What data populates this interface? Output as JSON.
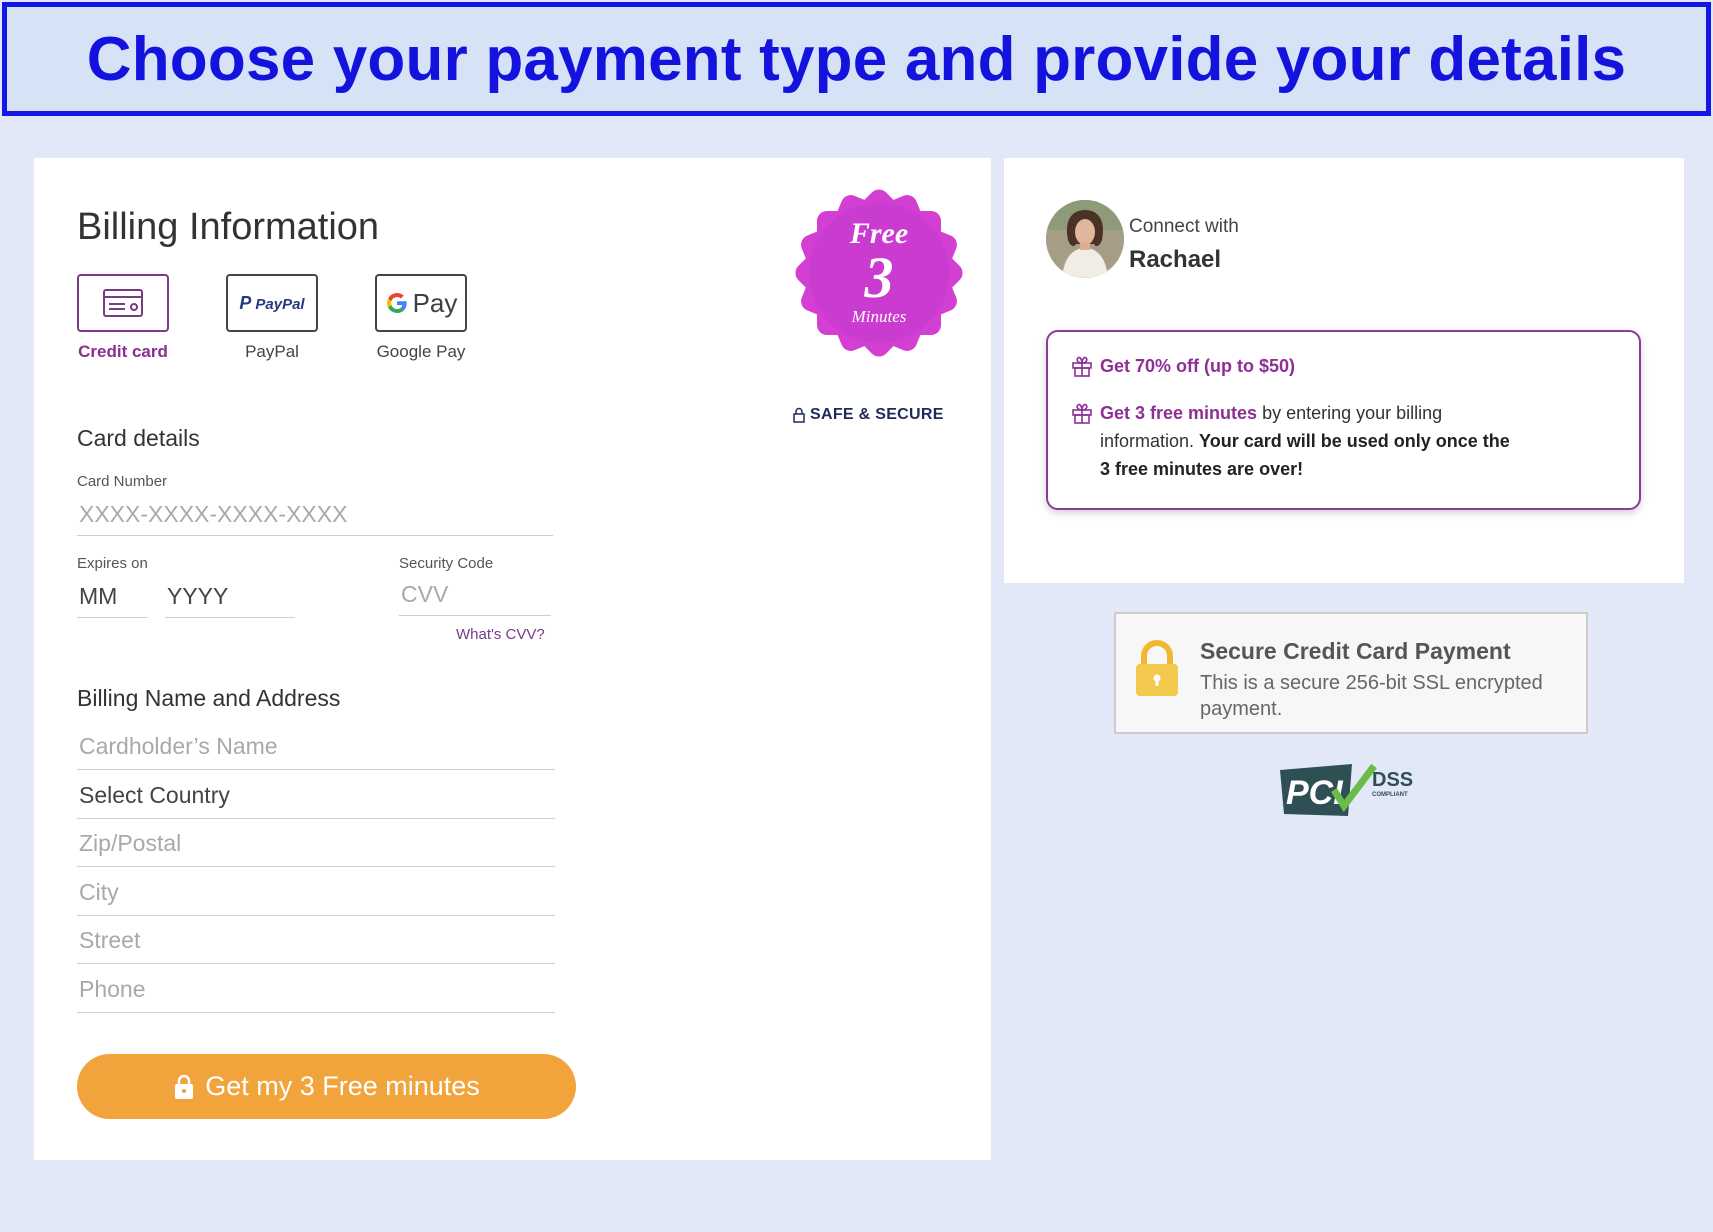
{
  "banner": {
    "title": "Choose your payment type and provide your details"
  },
  "billing": {
    "title": "Billing Information",
    "methods": [
      {
        "label": "Credit card",
        "icon": "credit-card-icon",
        "active": true
      },
      {
        "label": "PayPal",
        "icon": "paypal-logo"
      },
      {
        "label": "Google Pay",
        "icon": "google-pay-logo"
      }
    ],
    "paypal_logo_text": "PayPal",
    "gpay_logo_text": "Pay",
    "badge": {
      "free": "Free",
      "number": "3",
      "minutes": "Minutes",
      "color": "#d23fd2"
    },
    "safe_label": "SAFE & SECURE",
    "card_details_title": "Card details",
    "card_number_label": "Card Number",
    "card_number_placeholder": "XXXX-XXXX-XXXX-XXXX",
    "expires_label": "Expires on",
    "mm_placeholder": "MM",
    "yyyy_placeholder": "YYYY",
    "security_code_label": "Security Code",
    "cvv_placeholder": "CVV",
    "whats_cvv": "What's CVV?",
    "address_title": "Billing Name and Address",
    "cardholder_placeholder": "Cardholder’s Name",
    "country_placeholder": "Select Country",
    "zip_placeholder": "Zip/Postal",
    "city_placeholder": "City",
    "street_placeholder": "Street",
    "phone_placeholder": "Phone",
    "cta_label": "Get my 3 Free minutes",
    "cta_color": "#f0a43b"
  },
  "advisor": {
    "connect_text": "Connect with",
    "name": "Rachael",
    "offer1": "Get 70% off (up to $50)",
    "offer2_highlight": "Get 3 free minutes",
    "offer2_text": " by entering your billing",
    "offer2_line2": "information. ",
    "offer2_bold": "Your card will be used only once the",
    "offer2_line3": "3 free minutes are over!"
  },
  "secure": {
    "title": "Secure Credit Card Payment",
    "description": "This is a secure 256-bit SSL encrypted payment."
  },
  "pci": {
    "text1": "PCI",
    "text2": "DSS",
    "text3": "COMPLIANT"
  }
}
